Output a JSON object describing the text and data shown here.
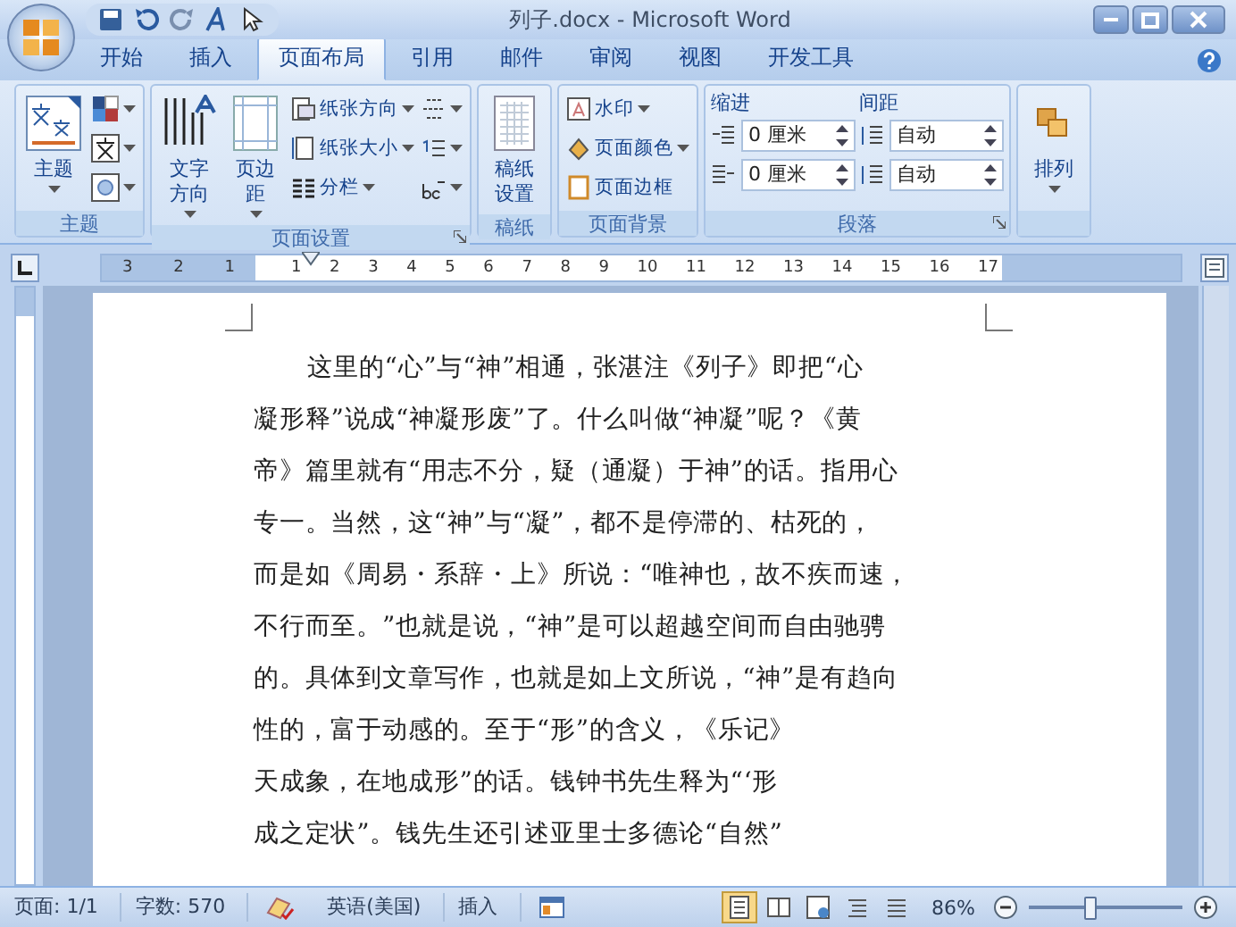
{
  "window": {
    "title": "列子.docx - Microsoft Word"
  },
  "tabs": [
    {
      "label": "开始",
      "selected": false
    },
    {
      "label": "插入",
      "selected": false
    },
    {
      "label": "页面布局",
      "selected": true
    },
    {
      "label": "引用",
      "selected": false
    },
    {
      "label": "邮件",
      "selected": false
    },
    {
      "label": "审阅",
      "selected": false
    },
    {
      "label": "视图",
      "selected": false
    },
    {
      "label": "开发工具",
      "selected": false
    }
  ],
  "ribbon": {
    "groups": [
      {
        "label": "主题",
        "launcher": false,
        "columns": [
          [
            {
              "kind": "large",
              "label": "主题",
              "dropdown": true
            }
          ],
          [
            {
              "kind": "small",
              "dropdown": true
            },
            {
              "kind": "small",
              "dropdown": true
            },
            {
              "kind": "small",
              "dropdown": true
            }
          ]
        ]
      },
      {
        "label": "页面设置",
        "launcher": true,
        "columns": [
          [
            {
              "kind": "large",
              "label": "文字方向",
              "dropdown": true
            }
          ],
          [
            {
              "kind": "large",
              "label": "页边距",
              "dropdown": true
            }
          ],
          [
            {
              "kind": "small",
              "label": "纸张方向",
              "dropdown": true
            },
            {
              "kind": "small",
              "label": "纸张大小",
              "dropdown": true
            },
            {
              "kind": "small",
              "label": "分栏",
              "dropdown": true
            }
          ],
          [
            {
              "kind": "small",
              "dropdown": true
            },
            {
              "kind": "small",
              "dropdown": true
            },
            {
              "kind": "small",
              "dropdown": true
            }
          ]
        ]
      },
      {
        "label": "稿纸",
        "launcher": false,
        "columns": [
          [
            {
              "kind": "large",
              "label": "稿纸设置",
              "dropdown": false
            }
          ]
        ]
      },
      {
        "label": "页面背景",
        "launcher": false,
        "columns": [
          [
            {
              "kind": "small",
              "label": "水印",
              "dropdown": true
            },
            {
              "kind": "small",
              "label": "页面颜色",
              "dropdown": true
            },
            {
              "kind": "small",
              "label": "页面边框",
              "dropdown": false
            }
          ]
        ]
      },
      {
        "label": "段落",
        "launcher": true,
        "columns": [
          [
            {
              "kind": "heading",
              "label": "缩进"
            },
            {
              "kind": "spin",
              "value": "0 厘米"
            },
            {
              "kind": "spin",
              "value": "0 厘米"
            }
          ],
          [
            {
              "kind": "heading",
              "label": "间距"
            },
            {
              "kind": "spin",
              "value": "自动"
            },
            {
              "kind": "spin",
              "value": "自动"
            }
          ]
        ]
      },
      {
        "launcher": false,
        "columns": [
          [
            {
              "kind": "large",
              "label": "排列",
              "dropdown": true
            }
          ]
        ]
      }
    ]
  },
  "ruler": {
    "left_marks": [
      "3",
      "2",
      "1"
    ],
    "marks": [
      "1",
      "2",
      "3",
      "4",
      "5",
      "6",
      "7",
      "8",
      "9",
      "10",
      "11",
      "12",
      "13",
      "14",
      "15",
      "16",
      "17"
    ]
  },
  "document": {
    "lines": [
      {
        "text": "这里的“心”与“神”相通，张湛注《列子》即把“心",
        "indent": true
      },
      {
        "text": "凝形释”说成“神凝形废”了。什么叫做“神凝”呢？《黄",
        "indent": false
      },
      {
        "text": "帝》篇里就有“用志不分，疑（通凝）于神”的话。指用心",
        "indent": false
      },
      {
        "text": "专一。当然，这“神”与“凝”，都不是停滞的、枯死的，",
        "indent": false
      },
      {
        "text": "而是如《周易・系辞・上》所说：“唯神也，故不疾而速，",
        "indent": false
      },
      {
        "text": "不行而至。”也就是说，“神”是可以超越空间而自由驰骋",
        "indent": false
      },
      {
        "text": "的。具体到文章写作，也就是如上文所说，“神”是有趋向",
        "indent": false
      },
      {
        "text": "性的，富于动感的。至于“形”的含义，《乐记》",
        "indent": false
      },
      {
        "text": "天成象，在地成形”的话。钱钟书先生释为“‘形",
        "indent": false
      },
      {
        "text": "成之定状”。钱先生还引述亚里士多德论“自然”",
        "indent": false
      }
    ]
  },
  "status_bar": {
    "items": [
      {
        "kind": "text",
        "text": "页面: 1/1"
      },
      {
        "kind": "text",
        "text": "字数: 570"
      },
      {
        "kind": "proofing"
      },
      {
        "kind": "text",
        "text": "英语(美国)"
      },
      {
        "kind": "text",
        "text": "插入"
      },
      {
        "kind": "macro"
      }
    ],
    "views": [
      {
        "kind": "print",
        "selected": true
      },
      {
        "kind": "reading",
        "selected": false
      },
      {
        "kind": "web",
        "selected": false
      },
      {
        "kind": "outline",
        "selected": false
      },
      {
        "kind": "draft",
        "selected": false
      }
    ],
    "zoom": {
      "label": "86%",
      "level": 0.4
    }
  }
}
